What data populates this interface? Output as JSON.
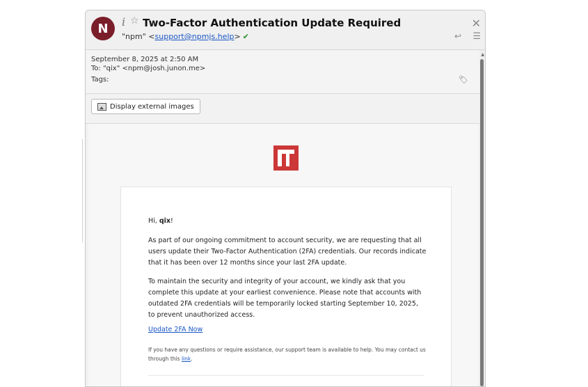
{
  "header": {
    "avatar_letter": "N",
    "subject": "Two-Factor Authentication Update Required",
    "from_name": "\"npm\" <",
    "from_email": "support@npmjs.help",
    "from_suffix": ">"
  },
  "meta": {
    "date": "September 8, 2025 at 2:50 AM",
    "to": "To: \"qix\" <npm@josh.junon.me>",
    "tags": "Tags:"
  },
  "toolbar": {
    "display_images_label": "Display external images"
  },
  "message": {
    "greeting_prefix": "Hi, ",
    "greeting_name": "qix",
    "greeting_suffix": "!",
    "paragraph1": "As part of our ongoing commitment to account security, we are requesting that all users update their Two-Factor Authentication (2FA) credentials. Our records indicate that it has been over 12 months since your last 2FA update.",
    "paragraph2": "To maintain the security and integrity of your account, we kindly ask that you complete this update at your earliest convenience. Please note that accounts with outdated 2FA credentials will be temporarily locked starting September 10, 2025, to prevent unauthorized access.",
    "cta_label": "Update 2FA Now",
    "support_text": "If you have any questions or require assistance, our support team is available to help. You may contact us through this ",
    "support_link": "link",
    "support_end": "."
  },
  "colors": {
    "avatar": "#7a1e2a",
    "npm_red": "#cb3837",
    "link": "#1a57c5",
    "verified": "#2d8f2d"
  },
  "icons": [
    "info-icon",
    "star-icon",
    "check-icon",
    "close-icon",
    "reply-icon",
    "menu-icon",
    "tag-icon",
    "image-icon",
    "npm-logo"
  ]
}
